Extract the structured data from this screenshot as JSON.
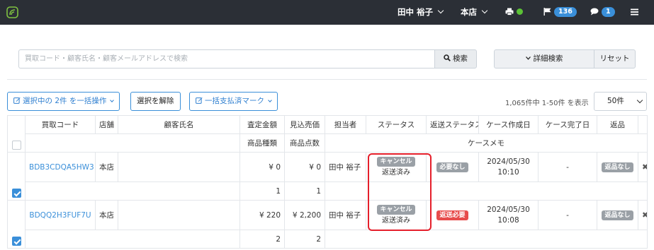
{
  "header": {
    "user_name": "田中 裕子",
    "store": "本店",
    "flag_count": "136",
    "message_count": "1"
  },
  "search": {
    "placeholder": "買取コード・顧客氏名・顧客メールアドレスで検索",
    "search_label": "検索",
    "advanced_label": "詳細検索",
    "reset_label": "リセット"
  },
  "actions": {
    "bulk_label": "選択中の 2件 を一括操作",
    "deselect_label": "選択を解除",
    "payment_label": "一括支払済マーク",
    "count_text": "1,065件中 1-50件 を表示",
    "per_page": "50件"
  },
  "table": {
    "headers": {
      "code": "買取コード",
      "store": "店舗",
      "customer": "顧客氏名",
      "appraisal": "査定金額",
      "estimated": "見込売価",
      "staff": "担当者",
      "status": "ステータス",
      "return_status": "返送ステータス",
      "created": "ケース作成日",
      "completed": "ケース完了日",
      "returned": "返品",
      "item_types": "商品種類",
      "item_count": "商品点数",
      "memo": "ケースメモ"
    },
    "rows": [
      {
        "code": "BDB3CDQA5HW3",
        "store": "本店",
        "customer": "",
        "appraisal": "¥ 0",
        "estimated": "¥ 0",
        "staff": "田中 裕子",
        "status_tag": "キャンセル",
        "status_sub": "返送済み",
        "return_tag": "必要なし",
        "created_date": "2024/05/30",
        "created_time": "10:10",
        "completed": "-",
        "returned_tag": "返品なし",
        "item_types": "1",
        "item_count": "1"
      },
      {
        "code": "BDQQ2H3FUF7U",
        "store": "本店",
        "customer": "",
        "appraisal": "¥ 220",
        "estimated": "¥ 2,200",
        "staff": "田中 裕子",
        "status_tag": "キャンセル",
        "status_sub": "返送済み",
        "return_tag": "返送必要",
        "created_date": "2024/05/30",
        "created_time": "10:08",
        "completed": "-",
        "returned_tag": "返品なし",
        "item_types": "2",
        "item_count": "2"
      }
    ]
  },
  "colors": {
    "topbar": "#2b2f36",
    "accent": "#3a8fd9",
    "tag_gray": "#9aa0a6",
    "tag_red": "#e74c4c",
    "highlight": "#e51f2b"
  }
}
